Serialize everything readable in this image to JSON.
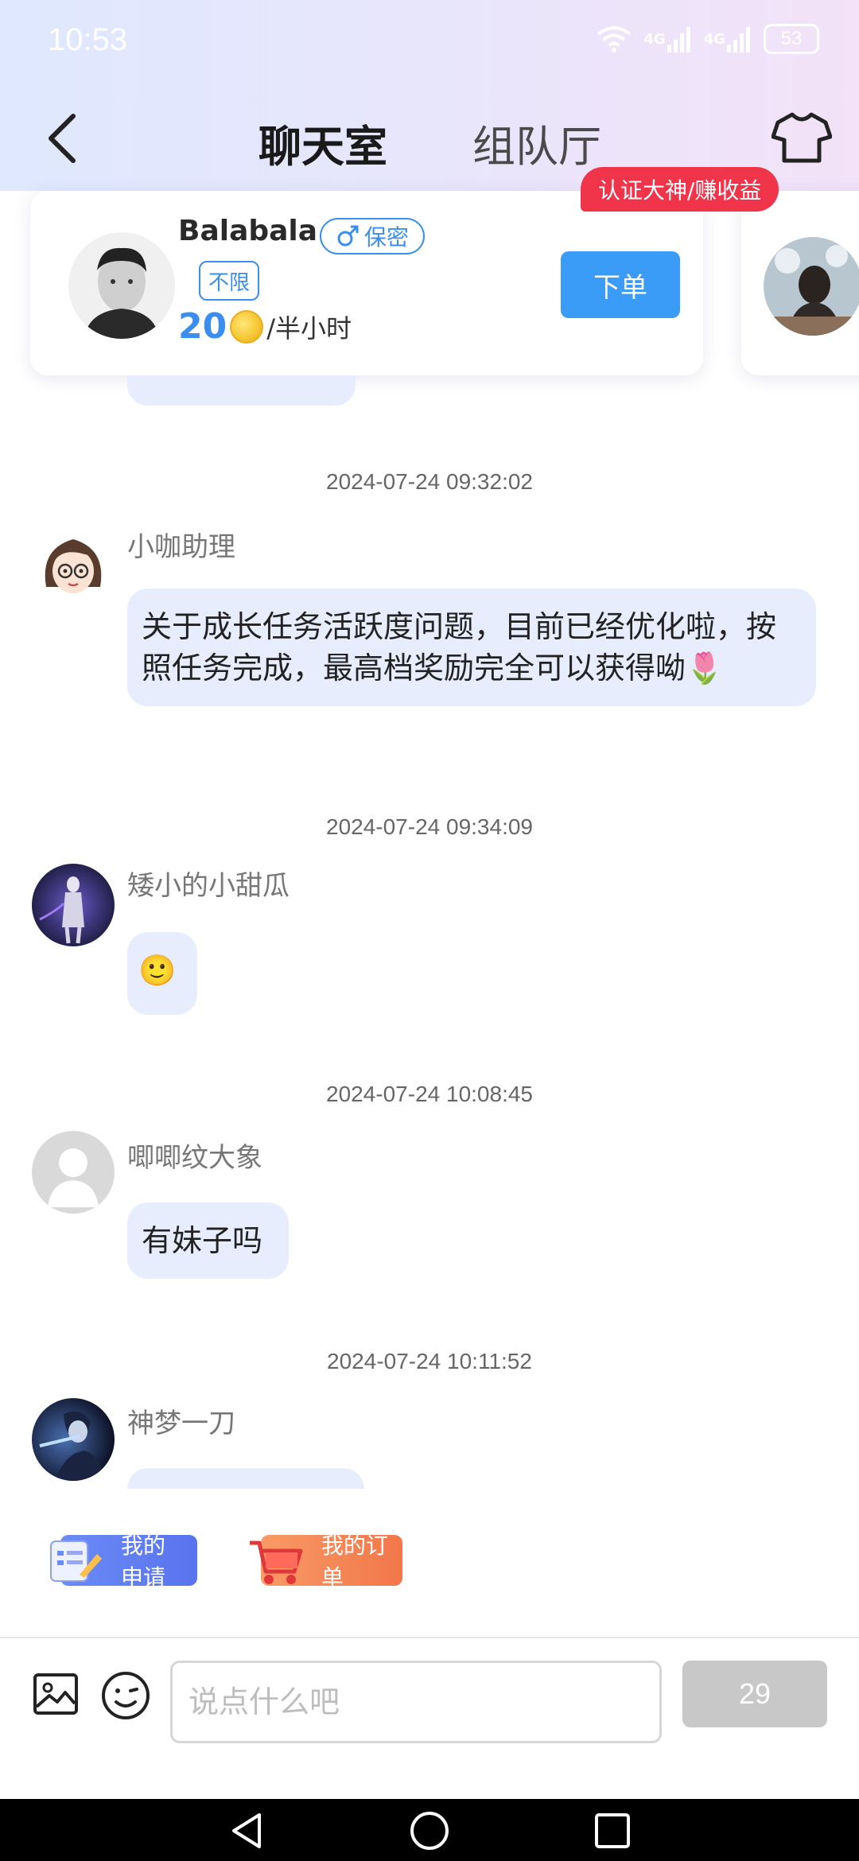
{
  "status_bar": {
    "time": "10:53",
    "battery": "53",
    "net1": "4G",
    "net2": "4G"
  },
  "header": {
    "tabs": [
      {
        "label": "聊天室",
        "active": true
      },
      {
        "label": "组队厅",
        "active": false
      }
    ],
    "accent_color": "#3a8ef0"
  },
  "card": {
    "name": "Balabala",
    "gender_tag": "保密",
    "limit_tag": "不限",
    "price": "20",
    "price_unit": "/半小时",
    "order_button": "下单",
    "cert_badge": "认证大神/赚收益"
  },
  "messages": [
    {
      "timestamp": "2024-07-24 09:32:02",
      "sender": "小咖助理",
      "text": "关于成长任务活跃度问题，目前已经优化啦，按照任务完成，最高档奖励完全可以获得呦🌷",
      "avatar": "cartoon-girl-avatar"
    },
    {
      "timestamp": "2024-07-24 09:34:09",
      "sender": "矮小的小甜瓜",
      "text": "🙂",
      "avatar": "game-character-avatar"
    },
    {
      "timestamp": "2024-07-24 10:08:45",
      "sender": "唧唧纹大象",
      "text": "有妹子吗",
      "avatar": "default-avatar"
    },
    {
      "timestamp": "2024-07-24 10:11:52",
      "sender": "神梦一刀",
      "text": "",
      "avatar": "anime-avatar"
    }
  ],
  "quick_actions": {
    "apply": "我的申请",
    "orders": "我的订单"
  },
  "input": {
    "placeholder": "说点什么吧",
    "send_label": "29"
  }
}
